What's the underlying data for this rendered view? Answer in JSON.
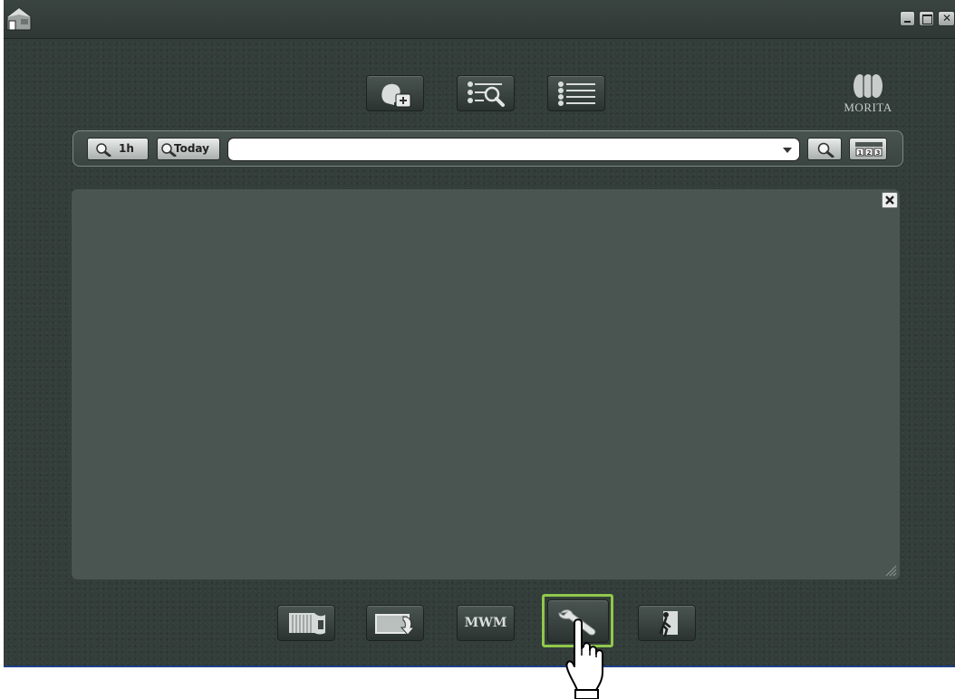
{
  "window": {
    "controls": [
      "minimize-icon",
      "maximize-icon",
      "close-icon"
    ]
  },
  "brand": {
    "logo_text": "MORITA"
  },
  "top_toolbar": {
    "buttons": [
      {
        "name": "new-patient-button",
        "icon": "head-plus-icon"
      },
      {
        "name": "patient-search-button",
        "icon": "list-magnifier-icon"
      },
      {
        "name": "patient-list-button",
        "icon": "list-icon"
      }
    ]
  },
  "search": {
    "btn_1h": "1h",
    "btn_today": "Today",
    "query_value": "",
    "icons": [
      "search-icon",
      "numbered-layout-icon"
    ]
  },
  "bottom_toolbar": {
    "buttons": [
      {
        "name": "panoramic-button",
        "icon": "panoramic-icon"
      },
      {
        "name": "import-button",
        "icon": "image-import-icon"
      },
      {
        "name": "mwm-button",
        "label": "MWM"
      },
      {
        "name": "settings-button",
        "icon": "wrench-icon",
        "selected": true
      },
      {
        "name": "exit-button",
        "icon": "exit-door-icon"
      }
    ]
  },
  "colors": {
    "background": "#333d3a",
    "panel": "#4a5552",
    "selected_highlight": "#8fc84a",
    "logo": "#c8ccca"
  }
}
